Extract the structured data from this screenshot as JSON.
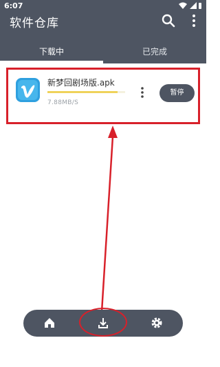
{
  "status_bar": {
    "time": "6:07"
  },
  "app_bar": {
    "title": "软件仓库"
  },
  "tabs": [
    {
      "label": "下载中",
      "selected": true
    },
    {
      "label": "已完成",
      "selected": false
    }
  ],
  "download_item": {
    "file_name": "新梦回剧场版.apk",
    "progress": 0.9,
    "speed": "7.88MB/S",
    "pause_label": "暂停",
    "icon": "vimeo-v-app-icon"
  },
  "bottom_nav": {
    "items": [
      {
        "icon": "home-icon"
      },
      {
        "icon": "download-icon",
        "selected": true
      },
      {
        "icon": "settings-icon"
      }
    ]
  },
  "colors": {
    "header": "#4e5562",
    "accent_red": "#d8202a",
    "progress": "#efd25a",
    "app_icon": "#2fa0df"
  }
}
